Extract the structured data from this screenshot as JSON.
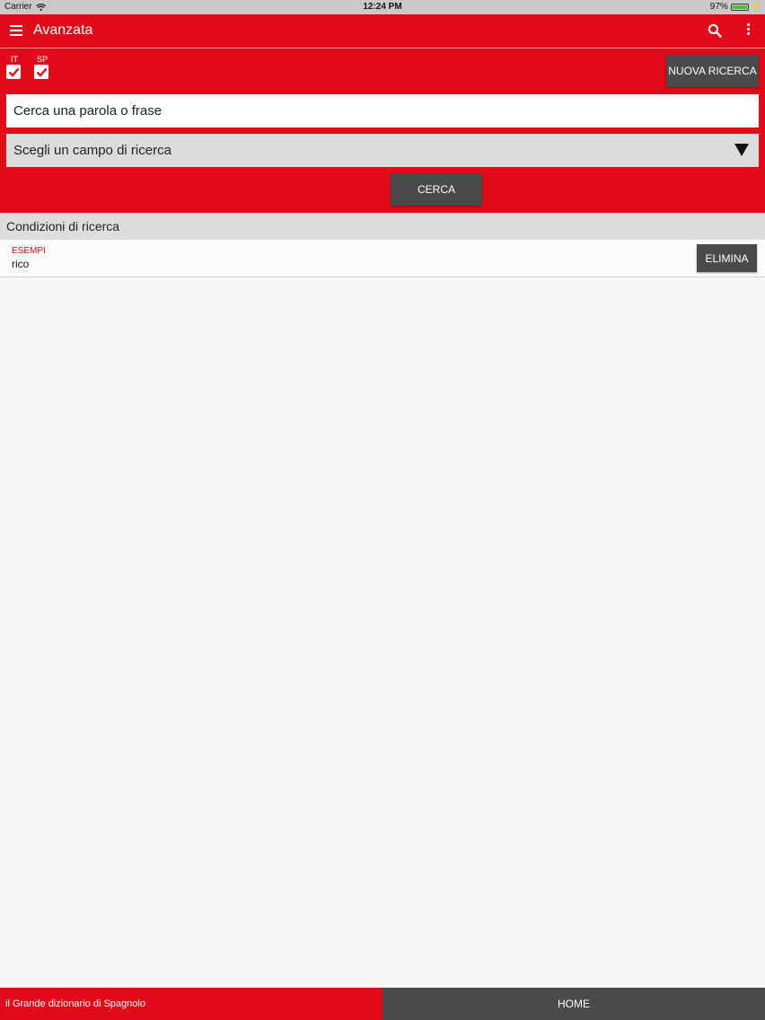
{
  "status_bar": {
    "carrier": "Carrier",
    "time": "12:24 PM",
    "battery_text": "97%",
    "battery_level": 0.97,
    "battery_color": "#3cc63c"
  },
  "app_bar": {
    "title": "Avanzata",
    "icons": [
      "menu-icon",
      "search-icon",
      "more-vert-icon"
    ]
  },
  "languages": [
    {
      "label": "IT",
      "checked": true
    },
    {
      "label": "SP",
      "checked": true
    }
  ],
  "new_search_button": "NUOVA RICERCA",
  "search": {
    "placeholder": "Cerca una parola o frase",
    "value": ""
  },
  "field_select": {
    "selected": "Scegli un campo di ricerca"
  },
  "search_button": "CERCA",
  "conditions": {
    "title": "Condizioni di ricerca",
    "items": [
      {
        "type": "ESEMPI",
        "value": "rico",
        "delete_label": "ELIMINA"
      }
    ]
  },
  "footer": {
    "app_name": "il Grande dizionario di Spagnolo",
    "home_label": "HOME"
  },
  "colors": {
    "accent": "#e00a18",
    "dark_button": "#4a4a4a",
    "background": "#f8f8f9"
  }
}
